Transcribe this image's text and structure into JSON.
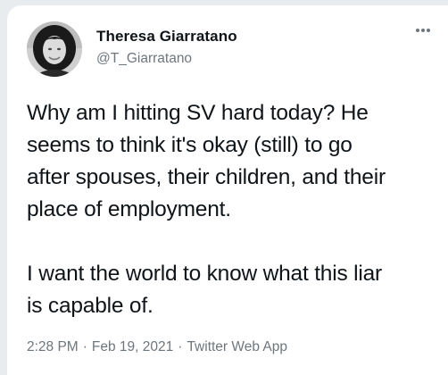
{
  "tweet": {
    "author": {
      "name": "Theresa Giarratano",
      "handle": "@T_Giarratano",
      "avatar_icon": "profile-photo"
    },
    "more_icon": "more-options-icon",
    "lines": [
      "Why am I hitting SV hard today?  He",
      "seems to think it's okay (still) to go",
      "after spouses, their children, and their",
      "place of employment."
    ],
    "lines2": [
      "I want the world to know what this liar",
      "is capable of."
    ],
    "time": "2:28 PM",
    "separator": "·",
    "date": "Feb 19, 2021",
    "source": "Twitter Web App"
  },
  "colors": {
    "background": "#e9ecef",
    "card": "#ffffff",
    "text": "#0f1419",
    "secondary_text": "#6e767d"
  }
}
